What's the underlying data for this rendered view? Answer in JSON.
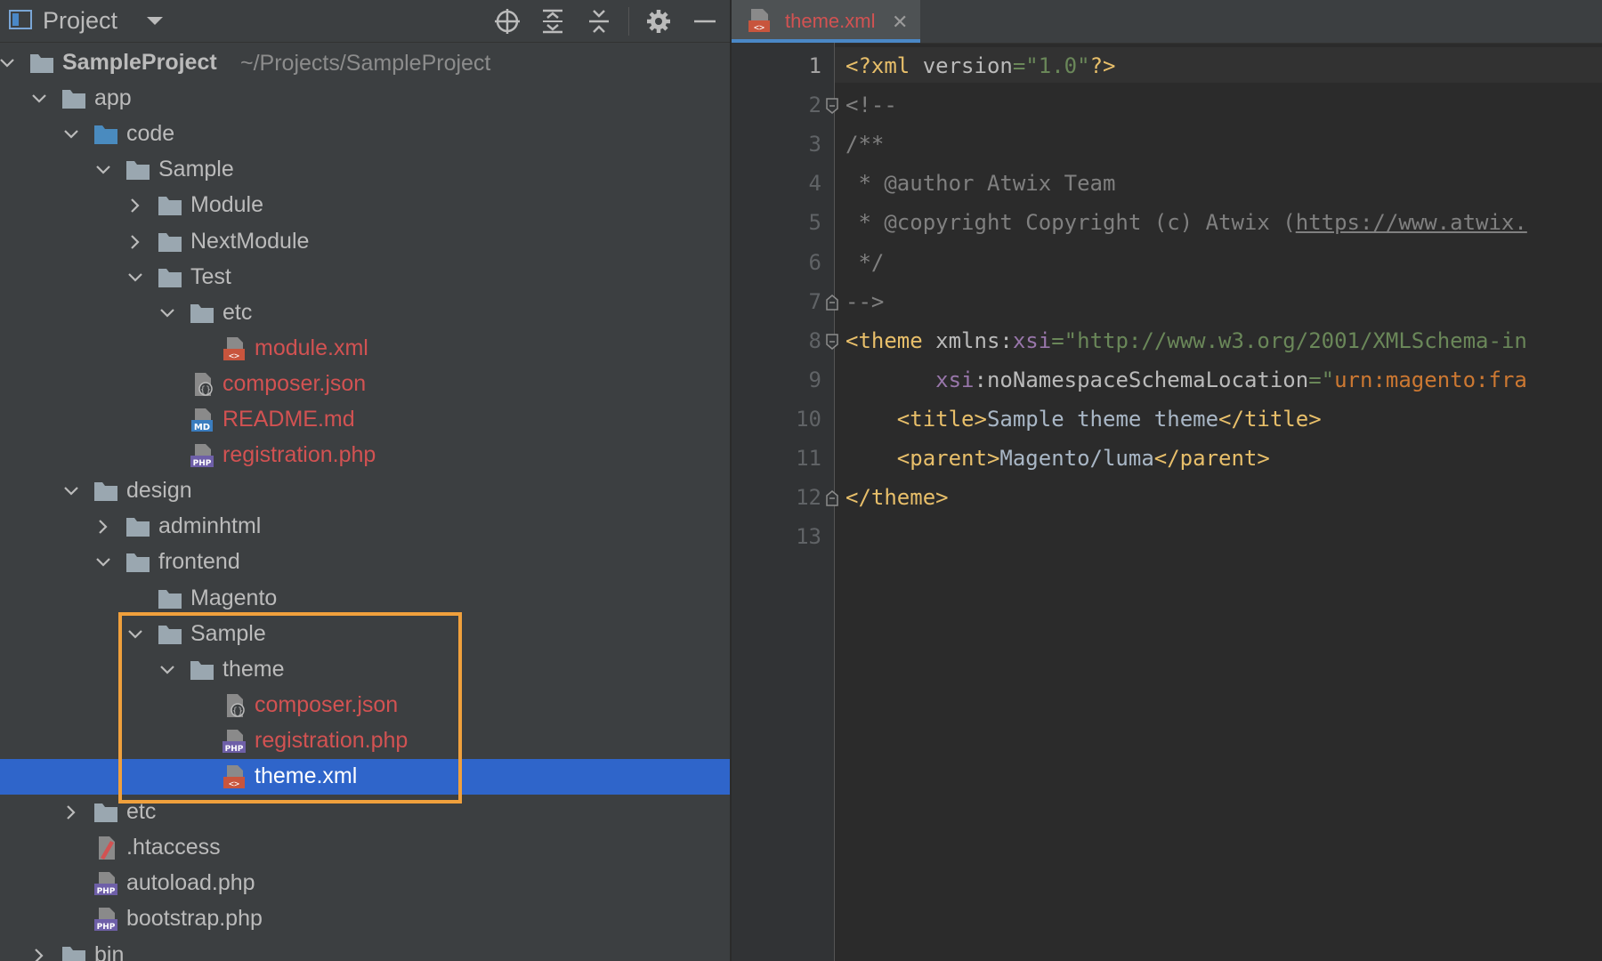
{
  "project_panel": {
    "title": "Project",
    "selected_file": "theme.xml"
  },
  "tree": [
    {
      "label": "SampleProject",
      "path": "~/Projects/SampleProject",
      "depth": 0,
      "chevron": "down",
      "icon": "folder-icon",
      "bold": true
    },
    {
      "label": "app",
      "depth": 1,
      "chevron": "down",
      "icon": "folder-icon"
    },
    {
      "label": "code",
      "depth": 2,
      "chevron": "down",
      "icon": "source-folder-icon"
    },
    {
      "label": "Sample",
      "depth": 3,
      "chevron": "down",
      "icon": "folder-icon"
    },
    {
      "label": "Module",
      "depth": 4,
      "chevron": "right",
      "icon": "folder-icon"
    },
    {
      "label": "NextModule",
      "depth": 4,
      "chevron": "right",
      "icon": "folder-icon"
    },
    {
      "label": "Test",
      "depth": 4,
      "chevron": "down",
      "icon": "folder-icon"
    },
    {
      "label": "etc",
      "depth": 5,
      "chevron": "down",
      "icon": "folder-icon"
    },
    {
      "label": "module.xml",
      "depth": 6,
      "chevron": "none",
      "icon": "xml-file-icon",
      "modified": true
    },
    {
      "label": "composer.json",
      "depth": 5,
      "chevron": "none",
      "icon": "json-file-icon",
      "modified": true
    },
    {
      "label": "README.md",
      "depth": 5,
      "chevron": "none",
      "icon": "markdown-file-icon",
      "modified": true
    },
    {
      "label": "registration.php",
      "depth": 5,
      "chevron": "none",
      "icon": "php-file-icon",
      "modified": true
    },
    {
      "label": "design",
      "depth": 2,
      "chevron": "down",
      "icon": "folder-icon"
    },
    {
      "label": "adminhtml",
      "depth": 3,
      "chevron": "right",
      "icon": "folder-icon"
    },
    {
      "label": "frontend",
      "depth": 3,
      "chevron": "down",
      "icon": "folder-icon"
    },
    {
      "label": "Magento",
      "depth": 4,
      "chevron": "none",
      "icon": "folder-icon"
    },
    {
      "label": "Sample",
      "depth": 4,
      "chevron": "down",
      "icon": "folder-icon"
    },
    {
      "label": "theme",
      "depth": 5,
      "chevron": "down",
      "icon": "folder-icon"
    },
    {
      "label": "composer.json",
      "depth": 6,
      "chevron": "none",
      "icon": "json-file-icon",
      "modified": true
    },
    {
      "label": "registration.php",
      "depth": 6,
      "chevron": "none",
      "icon": "php-file-icon",
      "modified": true
    },
    {
      "label": "theme.xml",
      "depth": 6,
      "chevron": "none",
      "icon": "xml-file-icon",
      "selected": true
    },
    {
      "label": "etc",
      "depth": 2,
      "chevron": "right",
      "icon": "folder-icon"
    },
    {
      "label": ".htaccess",
      "depth": 2,
      "chevron": "none",
      "icon": "htaccess-file-icon"
    },
    {
      "label": "autoload.php",
      "depth": 2,
      "chevron": "none",
      "icon": "php-file-icon"
    },
    {
      "label": "bootstrap.php",
      "depth": 2,
      "chevron": "none",
      "icon": "php-file-icon"
    },
    {
      "label": "bin",
      "depth": 1,
      "chevron": "right",
      "icon": "folder-icon"
    }
  ],
  "editor": {
    "tab": {
      "label": "theme.xml",
      "icon": "xml-file-icon"
    },
    "current_line": 1,
    "lines": [
      {
        "n": "1",
        "tokens": [
          {
            "t": "<?xml ",
            "c": "dec"
          },
          {
            "t": "version",
            "c": "att"
          },
          {
            "t": "=\"1.0\"",
            "c": "str"
          },
          {
            "t": "?>",
            "c": "dec"
          }
        ]
      },
      {
        "n": "2",
        "tokens": [
          {
            "t": "<!--",
            "c": "cm"
          }
        ]
      },
      {
        "n": "3",
        "tokens": [
          {
            "t": "/**",
            "c": "cm"
          }
        ]
      },
      {
        "n": "4",
        "tokens": [
          {
            "t": " * @author Atwix Team",
            "c": "cm"
          }
        ]
      },
      {
        "n": "5",
        "tokens": [
          {
            "t": " * @copyright Copyright (c) Atwix (",
            "c": "cm"
          },
          {
            "t": "https://www.atwix.",
            "c": "lnk"
          }
        ]
      },
      {
        "n": "6",
        "tokens": [
          {
            "t": " */",
            "c": "cm"
          }
        ]
      },
      {
        "n": "7",
        "tokens": [
          {
            "t": "-->",
            "c": "cm"
          }
        ]
      },
      {
        "n": "8",
        "tokens": [
          {
            "t": "<theme ",
            "c": "tag"
          },
          {
            "t": "xmlns:",
            "c": "att"
          },
          {
            "t": "xsi",
            "c": "ns"
          },
          {
            "t": "=\"http://www.w3.org/2001/XMLSchema-in",
            "c": "url"
          }
        ]
      },
      {
        "n": "9",
        "tokens": [
          {
            "t": "       ",
            "c": "txt"
          },
          {
            "t": "xsi",
            "c": "ns"
          },
          {
            "t": ":noNamespaceSchemaLocation",
            "c": "att"
          },
          {
            "t": "=\"",
            "c": "url"
          },
          {
            "t": "urn:magento:fra",
            "c": "urn"
          }
        ]
      },
      {
        "n": "10",
        "tokens": [
          {
            "t": "    ",
            "c": "txt"
          },
          {
            "t": "<title>",
            "c": "tag"
          },
          {
            "t": "Sample theme theme",
            "c": "txt"
          },
          {
            "t": "</title>",
            "c": "tag"
          }
        ]
      },
      {
        "n": "11",
        "tokens": [
          {
            "t": "    ",
            "c": "txt"
          },
          {
            "t": "<parent>",
            "c": "tag"
          },
          {
            "t": "Magento/luma",
            "c": "txt"
          },
          {
            "t": "</parent>",
            "c": "tag"
          }
        ]
      },
      {
        "n": "12",
        "tokens": [
          {
            "t": "</theme>",
            "c": "tag"
          }
        ]
      },
      {
        "n": "13",
        "tokens": []
      }
    ]
  },
  "colors": {
    "selection": "#2f65ca",
    "highlight_box": "#f0a03c",
    "modified_file": "#d25252",
    "folder": "#9aa7b0",
    "source_folder": "#4a8bbf"
  }
}
